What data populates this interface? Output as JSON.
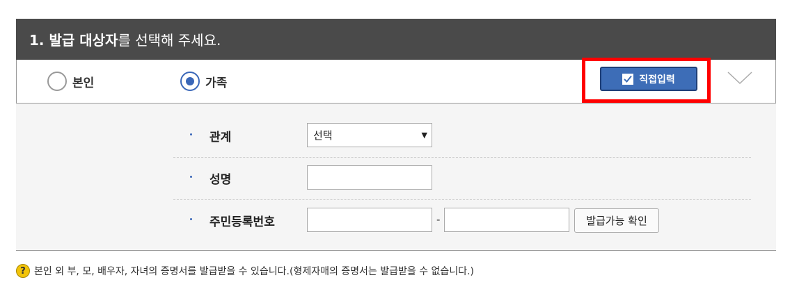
{
  "header": {
    "title_bold": "1. 발급 대상자",
    "title_rest": "를 선택해 주세요."
  },
  "selection": {
    "options": [
      {
        "label": "본인",
        "checked": false
      },
      {
        "label": "가족",
        "checked": true
      }
    ],
    "direct_input_label": "직접입력",
    "direct_input_checked": true,
    "expand_icon": "chevron-down-icon",
    "highlight_color": "#ff0000"
  },
  "form": {
    "relation_label": "관계",
    "relation_value": "선택",
    "name_label": "성명",
    "name_value": "",
    "rrn_label": "주민등록번호",
    "rrn_first": "",
    "rrn_separator": "-",
    "rrn_second": "",
    "verify_button": "발급가능 확인"
  },
  "notice": {
    "icon": "question-icon",
    "text": "본인 외 부, 모, 배우자, 자녀의 증명서를 발급받을 수 있습니다.(형제자매의 증명서는 발급받을 수 없습니다.)"
  },
  "colors": {
    "header_bg": "#4a4a4a",
    "accent": "#3d6db7",
    "notice_icon": "#f2c40a"
  }
}
